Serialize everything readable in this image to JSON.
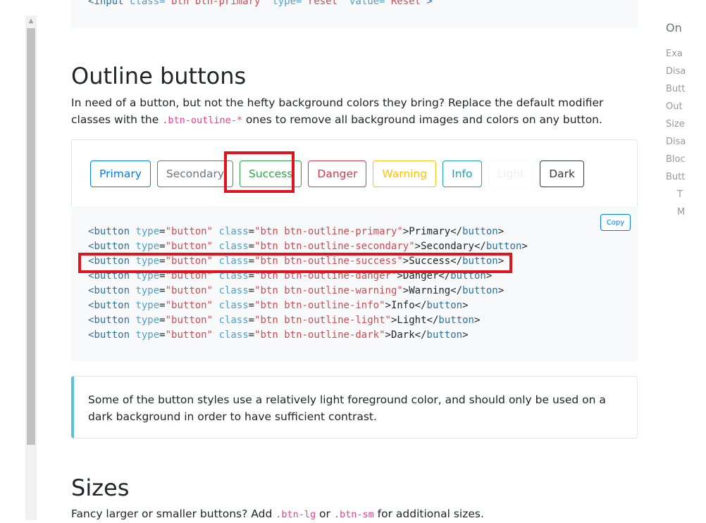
{
  "top_code": {
    "line_parts": [
      "<input",
      " class=",
      "\"btn btn-primary\"",
      " type=",
      "\"reset\"",
      " value=",
      "\"Reset\"",
      ">"
    ]
  },
  "outline_section": {
    "heading": "Outline buttons",
    "para_before": "In need of a button, but not the hefty background colors they bring? Replace the default modifier classes with the ",
    "para_code": ".btn-outline-*",
    "para_after": " ones to remove all background images and colors on any button."
  },
  "buttons": [
    {
      "label": "Primary"
    },
    {
      "label": "Secondary"
    },
    {
      "label": "Success"
    },
    {
      "label": "Danger"
    },
    {
      "label": "Warning"
    },
    {
      "label": "Info"
    },
    {
      "label": "Light"
    },
    {
      "label": "Dark"
    }
  ],
  "code_block": {
    "copy_label": "Copy",
    "tag_name": "button",
    "attr_type": "type",
    "type_value": "\"button\"",
    "attr_class": "class",
    "lines": [
      {
        "class_value": "\"btn btn-outline-primary\"",
        "text": "Primary"
      },
      {
        "class_value": "\"btn btn-outline-secondary\"",
        "text": "Secondary"
      },
      {
        "class_value": "\"btn btn-outline-success\"",
        "text": "Success"
      },
      {
        "class_value": "\"btn btn-outline-danger\"",
        "text": "Danger"
      },
      {
        "class_value": "\"btn btn-outline-warning\"",
        "text": "Warning"
      },
      {
        "class_value": "\"btn btn-outline-info\"",
        "text": "Info"
      },
      {
        "class_value": "\"btn btn-outline-light\"",
        "text": "Light"
      },
      {
        "class_value": "\"btn btn-outline-dark\"",
        "text": "Dark"
      }
    ]
  },
  "callout": {
    "text": "Some of the button styles use a relatively light foreground color, and should only be used on a dark background in order to have sufficient contrast."
  },
  "sizes_section": {
    "heading": "Sizes",
    "para_before": "Fancy larger or smaller buttons? Add ",
    "code_lg": ".btn-lg",
    "para_or": " or ",
    "code_sm": ".btn-sm",
    "para_after": " for additional sizes."
  },
  "toc": {
    "title": "On",
    "items": [
      "Exa",
      "Disa",
      "Butt",
      "Out",
      "Size",
      "Disa",
      "Bloc",
      "Butt",
      "T",
      "M"
    ]
  },
  "colors": {
    "highlight_box": "#e0141e",
    "callout_border": "#5bc0de",
    "primary": "#007bff",
    "success": "#28a745"
  }
}
